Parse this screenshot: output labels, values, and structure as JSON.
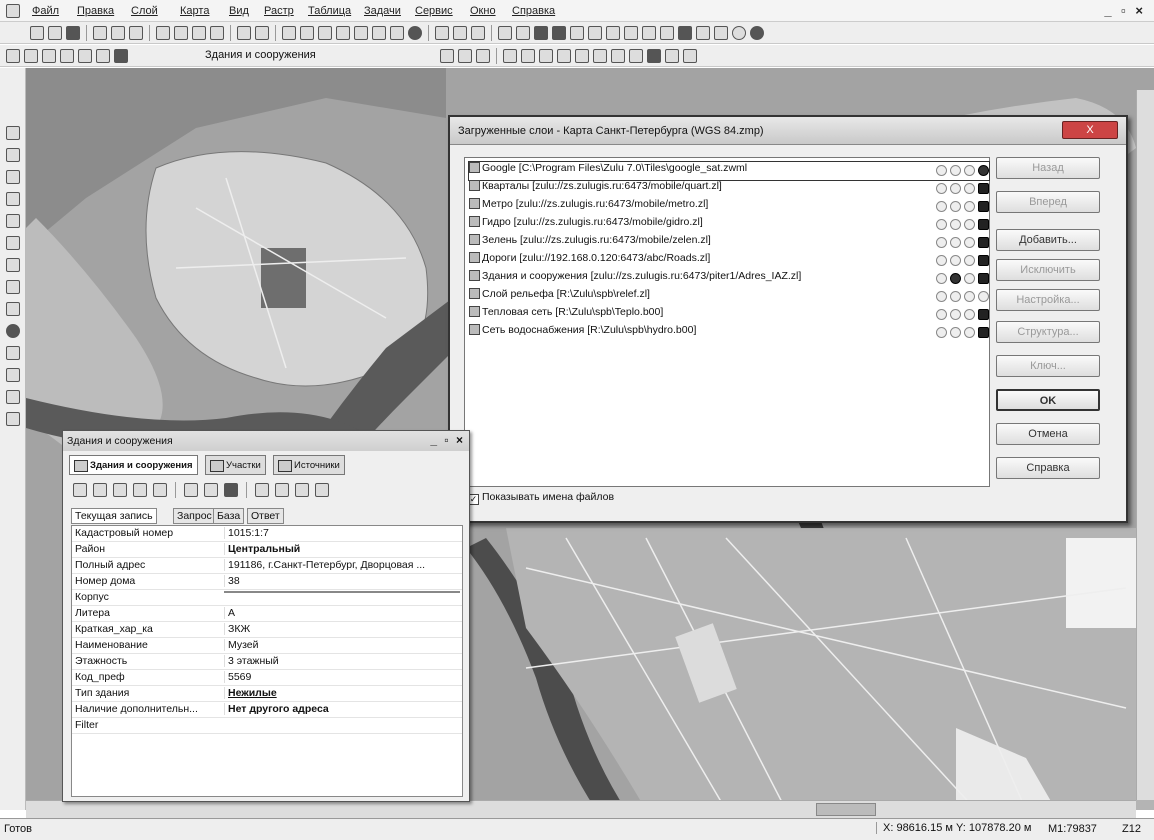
{
  "menu": {
    "items": [
      "Файл",
      "Правка",
      "Слой",
      "Карта",
      "Вид",
      "Растр",
      "Таблица",
      "Задачи",
      "Сервис",
      "Окно",
      "Справка"
    ],
    "window_controls": "_ ▫ ×"
  },
  "toolbar3": {
    "active_layer": "Здания и сооружения"
  },
  "dialog": {
    "title": "Загруженные слои - Карта Санкт-Петербурга (WGS 84.zmp)",
    "close_label": "X",
    "layers": [
      {
        "label": "Google  [C:\\Program Files\\Zulu 7.0\\Tiles\\google_sat.zwml",
        "selected": true
      },
      {
        "label": "Кварталы [zulu://zs.zulugis.ru:6473/mobile/quart.zl]"
      },
      {
        "label": "Метро [zulu://zs.zulugis.ru:6473/mobile/metro.zl]"
      },
      {
        "label": "Гидро [zulu://zs.zulugis.ru:6473/mobile/gidro.zl]"
      },
      {
        "label": "Зелень [zulu://zs.zulugis.ru:6473/mobile/zelen.zl]"
      },
      {
        "label": "Дороги [zulu://192.168.0.120:6473/abc/Roads.zl]"
      },
      {
        "label": "Здания и сооружения [zulu://zs.zulugis.ru:6473/piter1/Adres_IAZ.zl]"
      },
      {
        "label": "Слой рельефа [R:\\Zulu\\spb\\relef.zl]"
      },
      {
        "label": "Тепловая сеть [R:\\Zulu\\spb\\Teplo.b00]"
      },
      {
        "label": "Сеть водоснабжения [R:\\Zulu\\spb\\hydro.b00]"
      }
    ],
    "buttons": {
      "back": "Назад",
      "forward": "Вперед",
      "add": "Добавить...",
      "remove": "Исключить",
      "settings": "Настройка...",
      "structure": "Структура...",
      "key": "Ключ...",
      "ok": "OK",
      "cancel": "Отмена",
      "help": "Справка"
    },
    "show_filenames": "Показывать имена файлов"
  },
  "panel": {
    "title": "Здания и сооружения",
    "controls": "_ ▫ ×",
    "tabs": [
      "Здания и сооружения",
      "Участки",
      "Источники"
    ],
    "subtabs": [
      "Текущая запись",
      "Запрос",
      "База",
      "Ответ"
    ],
    "fields": [
      {
        "k": "Кадастровый номер",
        "v": "1015:1:7"
      },
      {
        "k": "Район",
        "v": "Центральный"
      },
      {
        "k": "Полный адрес",
        "v": "191186, г.Санкт-Петербург, Дворцовая ..."
      },
      {
        "k": "Номер дома",
        "v": "38"
      },
      {
        "k": "Корпус",
        "v": ""
      },
      {
        "k": "Литера",
        "v": "А"
      },
      {
        "k": "Краткая_хар_ка",
        "v": "ЗКЖ"
      },
      {
        "k": "Наименование",
        "v": "Музей"
      },
      {
        "k": "Этажность",
        "v": "3 этажный"
      },
      {
        "k": "Код_преф",
        "v": "5569"
      },
      {
        "k": "Тип здания",
        "v": "Нежилые"
      },
      {
        "k": "Наличие дополнительн...",
        "v": "Нет другого адреса"
      },
      {
        "k": "Filter",
        "v": ""
      }
    ]
  },
  "status": {
    "ready": "Готов",
    "coords": "X: 98616.15 м  Y: 107878.20 м",
    "scale": "М1:79837",
    "zoom": "Z12"
  }
}
